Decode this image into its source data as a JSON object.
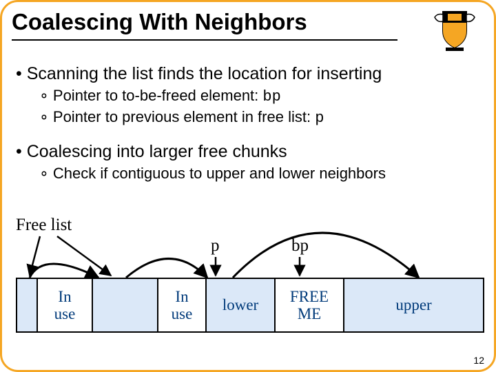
{
  "title": "Coalescing With Neighbors",
  "bullets": {
    "b1": "Scanning the list finds the location for inserting",
    "b1s1_pre": "Pointer to to-be-freed element: ",
    "b1s1_code": "bp",
    "b1s2_pre": "Pointer to previous element in free list: ",
    "b1s2_code": "p",
    "b2": "Coalescing into larger free chunks",
    "b2s1": "Check if contiguous to upper and lower neighbors"
  },
  "labels": {
    "freelist": "Free list",
    "p": "p",
    "bp": "bp"
  },
  "blocks": {
    "a_free": "",
    "b_inuse_top": "In",
    "b_inuse_bot": "use",
    "c_free": "",
    "d_inuse_top": "In",
    "d_inuse_bot": "use",
    "e_lower": "lower",
    "f_freeme_top": "FREE",
    "f_freeme_bot": "ME",
    "g_upper": "upper"
  },
  "pagenum": "12"
}
